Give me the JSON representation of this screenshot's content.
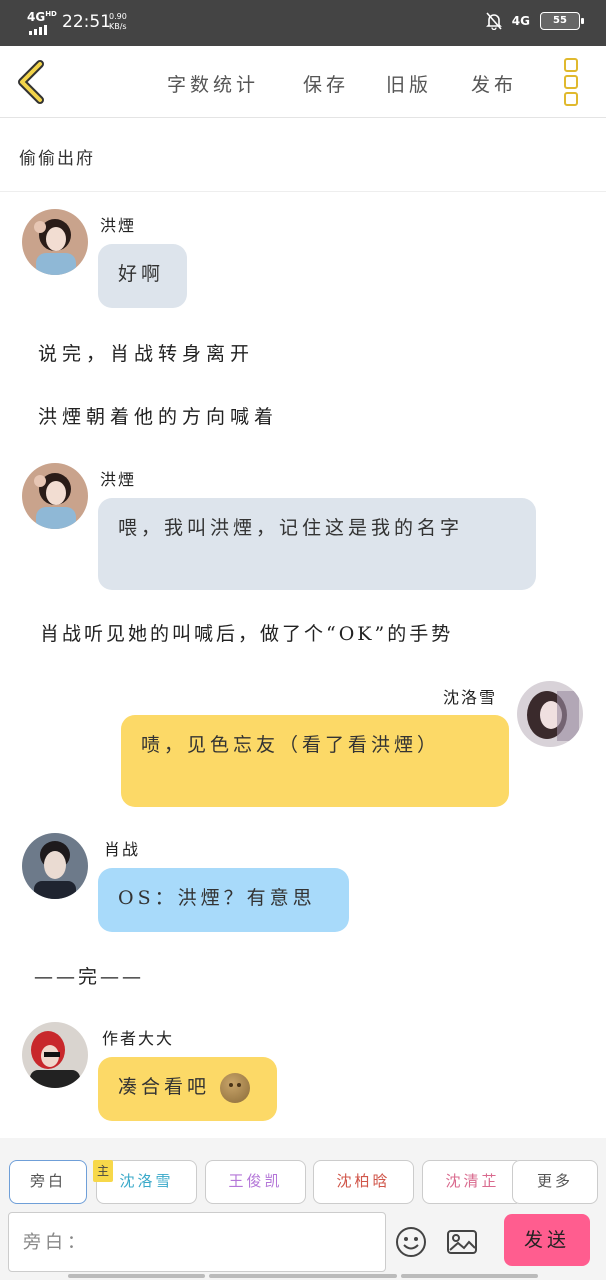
{
  "status": {
    "network": "4G",
    "network_sup": "HD",
    "time": "22:51",
    "speed": "0.90",
    "speed_unit": "KB/s",
    "net2": "4G",
    "battery": "55"
  },
  "nav": {
    "word_count": "字数统计",
    "save": "保存",
    "old_version": "旧版",
    "publish": "发布"
  },
  "story_title": "偷偷出府",
  "messages": {
    "m1_speaker": "洪煙",
    "m1_text": "好啊",
    "n1": "说完，肖战转身离开",
    "n2": "洪煙朝着他的方向喊着",
    "m2_speaker": "洪煙",
    "m2_text": "喂，我叫洪煙，记住这是我的名字",
    "n3": "肖战听见她的叫喊后，做了个“OK”的手势",
    "m3_speaker": "沈洛雪",
    "m3_text": "啧，见色忘友（看了看洪煙）",
    "m4_speaker": "肖战",
    "m4_text": "OS：洪煙？有意思",
    "n4": "——完——",
    "m5_speaker": "作者大大",
    "m5_text": "凑合看吧"
  },
  "bottom": {
    "chips": [
      "旁白",
      "沈洛雪",
      "王俊凯",
      "沈柏晗",
      "沈清芷",
      "更多"
    ],
    "zhu_badge": "主",
    "chip_colors": [
      "#555555",
      "#3aa9c9",
      "#b477d8",
      "#d0564a",
      "#d96a8e",
      "#555555"
    ],
    "input_placeholder": "旁白：",
    "send": "发送"
  },
  "colors": {
    "accent": "#e0b92e",
    "bubble_gray": "#dde4ec",
    "bubble_yellow": "#fcd967",
    "bubble_blue": "#a8dafa",
    "send": "#ff5d8f"
  }
}
